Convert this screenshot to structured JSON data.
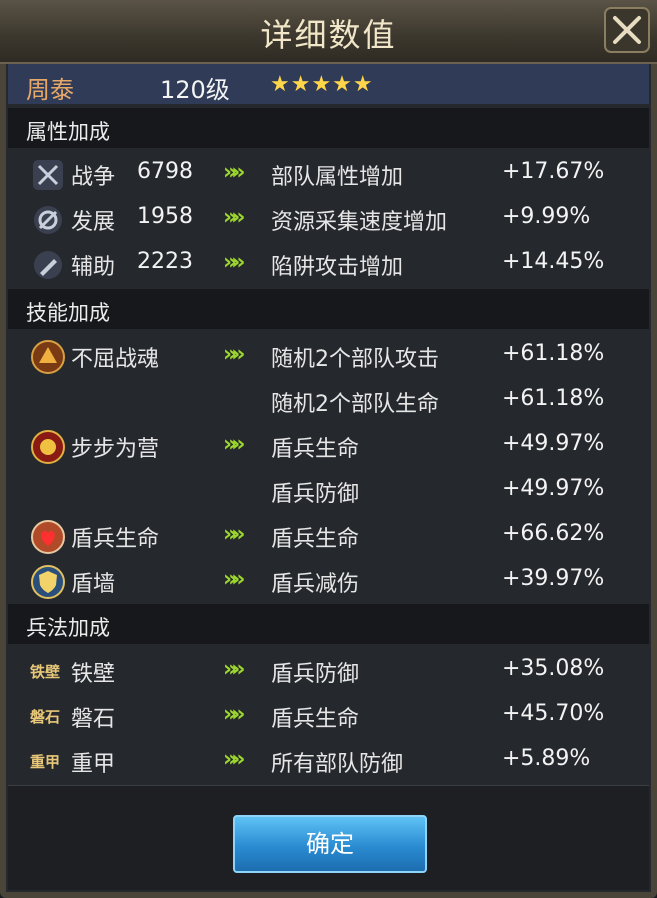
{
  "dialog": {
    "title": "详细数值"
  },
  "hero": {
    "name": "周泰",
    "level": "120级",
    "stars": "★★★★★"
  },
  "sections": {
    "attributes": "属性加成",
    "skills": "技能加成",
    "tactics": "兵法加成"
  },
  "attributes": [
    {
      "name": "战争",
      "value": "6798",
      "effect": "部队属性增加",
      "percent": "+17.67%",
      "icon": "swords-icon"
    },
    {
      "name": "发展",
      "value": "1958",
      "effect": "资源采集速度增加",
      "percent": "+9.99%",
      "icon": "develop-icon"
    },
    {
      "name": "辅助",
      "value": "2223",
      "effect": "陷阱攻击增加",
      "percent": "+14.45%",
      "icon": "assist-icon"
    }
  ],
  "skills": [
    {
      "name": "不屈战魂",
      "effect": "随机2个部队攻击",
      "percent": "+61.18%",
      "icon": "unyielding-soul-icon"
    },
    {
      "name": "",
      "effect": "随机2个部队生命",
      "percent": "+61.18%"
    },
    {
      "name": "步步为营",
      "effect": "盾兵生命",
      "percent": "+49.97%",
      "icon": "step-by-step-icon"
    },
    {
      "name": "",
      "effect": "盾兵防御",
      "percent": "+49.97%"
    },
    {
      "name": "盾兵生命",
      "effect": "盾兵生命",
      "percent": "+66.62%",
      "icon": "shield-life-icon"
    },
    {
      "name": "盾墙",
      "effect": "盾兵减伤",
      "percent": "+39.97%",
      "icon": "shield-wall-icon"
    }
  ],
  "tactics": [
    {
      "name": "铁壁",
      "effect": "盾兵防御",
      "percent": "+35.08%",
      "icon_text": "铁壁"
    },
    {
      "name": "磐石",
      "effect": "盾兵生命",
      "percent": "+45.70%",
      "icon_text": "磐石"
    },
    {
      "name": "重甲",
      "effect": "所有部队防御",
      "percent": "+5.89%",
      "icon_text": "重甲"
    }
  ],
  "arrow_glyph": "»»",
  "confirm_button": "确定"
}
